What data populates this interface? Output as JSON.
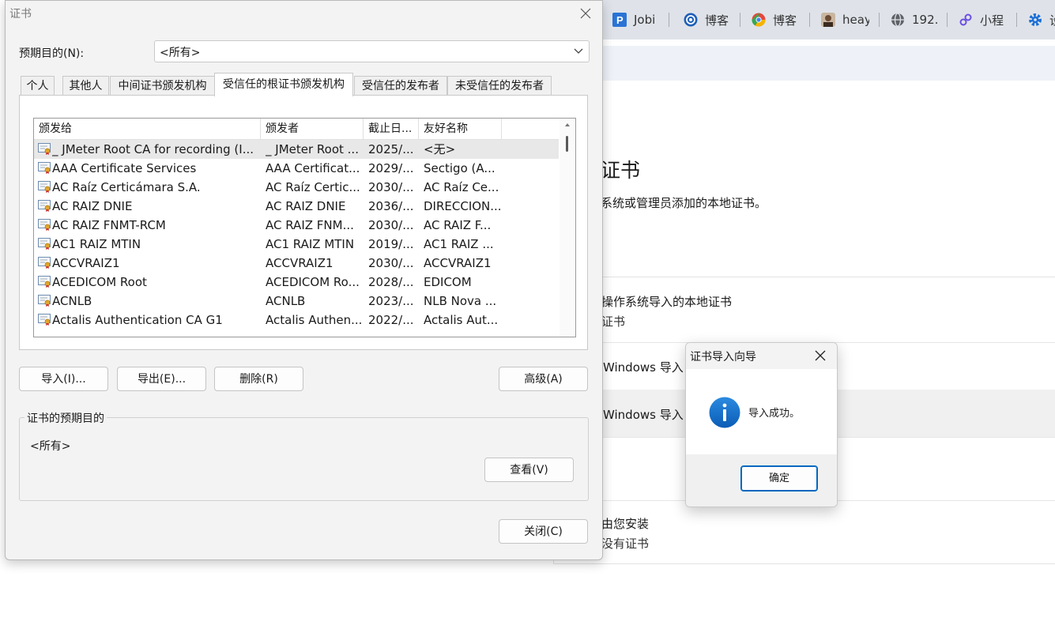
{
  "browser": {
    "tabs": [
      {
        "label": "Jobi",
        "icon": "p-logo-icon"
      },
      {
        "label": "博客",
        "icon": "cnblogs-icon"
      },
      {
        "label": "博客",
        "icon": "chrome-icon"
      },
      {
        "label": "heay",
        "icon": "avatar-icon"
      },
      {
        "label": "192.",
        "icon": "globe-icon"
      },
      {
        "label": "小程",
        "icon": "link-icon"
      },
      {
        "label": "设",
        "icon": "gear-icon"
      }
    ]
  },
  "settings": {
    "title": "证书",
    "description": "系统或管理员添加的本地证书。",
    "rows": [
      {
        "line1": "操作系统导入的本地证书",
        "line2": "证书"
      },
      {
        "line1": "Windows 导入",
        "line2": ""
      },
      {
        "line1": "Windows 导入",
        "line2": ""
      },
      {
        "line1": "由您安装",
        "line2": "没有证书"
      }
    ]
  },
  "dialog": {
    "title": "证书",
    "purpose_label": "预期目的(N):",
    "purpose_value": "<所有>",
    "tabs": [
      "个人",
      "其他人",
      "中间证书颁发机构",
      "受信任的根证书颁发机构",
      "受信任的发布者",
      "未受信任的发布者"
    ],
    "active_tab": "受信任的根证书颁发机构",
    "columns": [
      "颁发给",
      "颁发者",
      "截止日...",
      "友好名称"
    ],
    "rows": [
      {
        "issued_to": "_ JMeter Root CA for recording (I...",
        "issued_by": "_ JMeter Root ...",
        "expires": "2025/...",
        "friendly": "<无>"
      },
      {
        "issued_to": "AAA Certificate Services",
        "issued_by": "AAA Certificat...",
        "expires": "2029/...",
        "friendly": "Sectigo (A..."
      },
      {
        "issued_to": "AC Raíz Certicámara S.A.",
        "issued_by": "AC Raíz Certic...",
        "expires": "2030/...",
        "friendly": "AC Raíz Ce..."
      },
      {
        "issued_to": "AC RAIZ DNIE",
        "issued_by": "AC RAIZ DNIE",
        "expires": "2036/...",
        "friendly": "DIRECCION..."
      },
      {
        "issued_to": "AC RAIZ FNMT-RCM",
        "issued_by": "AC RAIZ FNM...",
        "expires": "2030/...",
        "friendly": "AC RAIZ F..."
      },
      {
        "issued_to": "AC1 RAIZ MTIN",
        "issued_by": "AC1 RAIZ MTIN",
        "expires": "2019/...",
        "friendly": "AC1 RAIZ ..."
      },
      {
        "issued_to": "ACCVRAIZ1",
        "issued_by": "ACCVRAIZ1",
        "expires": "2030/...",
        "friendly": "ACCVRAIZ1"
      },
      {
        "issued_to": "ACEDICOM Root",
        "issued_by": "ACEDICOM Ro...",
        "expires": "2028/...",
        "friendly": "EDICOM"
      },
      {
        "issued_to": "ACNLB",
        "issued_by": "ACNLB",
        "expires": "2023/...",
        "friendly": "NLB Nova ..."
      },
      {
        "issued_to": "Actalis Authentication CA G1",
        "issued_by": "Actalis Authen...",
        "expires": "2022/...",
        "friendly": "Actalis Aut..."
      }
    ],
    "buttons": {
      "import": "导入(I)...",
      "export": "导出(E)...",
      "remove": "删除(R)",
      "advanced": "高级(A)",
      "view": "查看(V)",
      "close": "关闭(C)"
    },
    "purposes_group_label": "证书的预期目的",
    "purposes_value": "<所有>"
  },
  "popup": {
    "title": "证书导入向导",
    "message": "导入成功。",
    "ok_label": "确定"
  }
}
